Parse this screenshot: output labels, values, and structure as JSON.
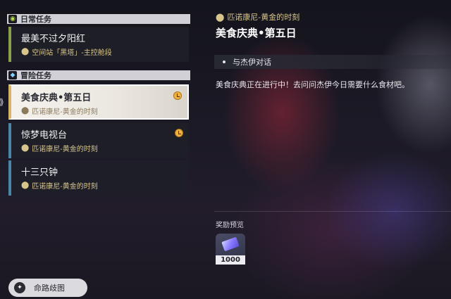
{
  "left": {
    "daily_header": "日常任务",
    "adventure_header": "冒险任务",
    "daily_quests": [
      {
        "title": "最美不过夕阳红",
        "location": "空间站「黑塔」-主控舱段"
      }
    ],
    "adventure_quests": [
      {
        "title": "美食庆典•第五日",
        "location": "匹诺康尼-黄金的时刻",
        "selected": true,
        "timed": true
      },
      {
        "title": "惊梦电视台",
        "location": "匹诺康尼-黄金的时刻",
        "timed": true
      },
      {
        "title": "十三只钟",
        "location": "匹诺康尼-黄金的时刻"
      }
    ],
    "bottom_button": "命路歧图"
  },
  "detail": {
    "location": "匹诺康尼-黄金的时刻",
    "title": "美食庆典•第五日",
    "objective": "与杰伊对话",
    "description": "美食庆典正在进行中！去问问杰伊今日需要什么食材吧。",
    "reward_label": "奖励预览",
    "rewards": [
      {
        "icon": "gem-icon",
        "count": "1000"
      }
    ]
  },
  "colors": {
    "location_text": "#d8c58c",
    "daily_accent": "#8aa04a",
    "adventure_accent": "#4a86a6",
    "timer_badge": "#f0b23c"
  }
}
